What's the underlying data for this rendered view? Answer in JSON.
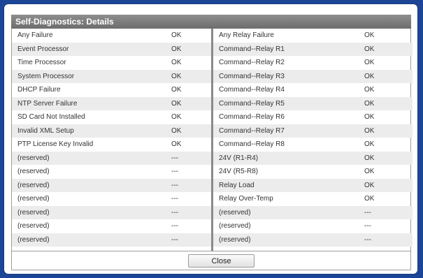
{
  "dialog": {
    "title": "Self-Diagnostics: Details",
    "close_label": "Close"
  },
  "left_column": [
    {
      "name": "Any Failure",
      "status": "OK"
    },
    {
      "name": "Event Processor",
      "status": "OK"
    },
    {
      "name": "Time Processor",
      "status": "OK"
    },
    {
      "name": "System Processor",
      "status": "OK"
    },
    {
      "name": "DHCP Failure",
      "status": "OK"
    },
    {
      "name": "NTP Server Failure",
      "status": "OK"
    },
    {
      "name": "SD Card Not Installed",
      "status": "OK"
    },
    {
      "name": "Invalid XML Setup",
      "status": "OK"
    },
    {
      "name": "PTP License Key Invalid",
      "status": "OK"
    },
    {
      "name": "(reserved)",
      "status": "---"
    },
    {
      "name": "(reserved)",
      "status": "---"
    },
    {
      "name": "(reserved)",
      "status": "---"
    },
    {
      "name": "(reserved)",
      "status": "---"
    },
    {
      "name": "(reserved)",
      "status": "---"
    },
    {
      "name": "(reserved)",
      "status": "---"
    },
    {
      "name": "(reserved)",
      "status": "---"
    }
  ],
  "right_column": [
    {
      "name": "Any Relay Failure",
      "status": "OK"
    },
    {
      "name": "Command--Relay R1",
      "status": "OK"
    },
    {
      "name": "Command--Relay R2",
      "status": "OK"
    },
    {
      "name": "Command--Relay R3",
      "status": "OK"
    },
    {
      "name": "Command--Relay R4",
      "status": "OK"
    },
    {
      "name": "Command--Relay R5",
      "status": "OK"
    },
    {
      "name": "Command--Relay R6",
      "status": "OK"
    },
    {
      "name": "Command--Relay R7",
      "status": "OK"
    },
    {
      "name": "Command--Relay R8",
      "status": "OK"
    },
    {
      "name": "24V (R1-R4)",
      "status": "OK"
    },
    {
      "name": "24V (R5-R8)",
      "status": "OK"
    },
    {
      "name": "Relay Load",
      "status": "OK"
    },
    {
      "name": "Relay Over-Temp",
      "status": "OK"
    },
    {
      "name": "(reserved)",
      "status": "---"
    },
    {
      "name": "(reserved)",
      "status": "---"
    },
    {
      "name": "(reserved)",
      "status": "---"
    }
  ]
}
